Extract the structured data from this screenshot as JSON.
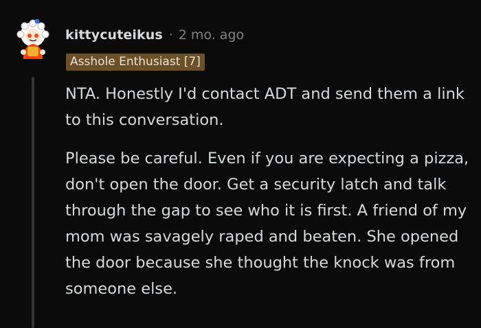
{
  "comment": {
    "username": "kittycuteikus",
    "separator": "·",
    "time_ago": "2 mo. ago",
    "flair": "Asshole Enthusiast [7]",
    "paragraphs": [
      "NTA. Honestly I'd contact ADT and send them a link to this conversation.",
      "Please be careful. Even if you are expecting a pizza, don't open the door. Get a security latch and talk through the gap to see who it is first. A friend of my mom was savagely raped and beaten. She opened the door because she thought the knock was from someone else."
    ]
  },
  "colors": {
    "background": "#0b0b0b",
    "text": "#d7dadc",
    "meta": "#818384",
    "flair_bg": "#6b5028",
    "thread_line": "#343536"
  },
  "icons": {
    "avatar": "snoo-avatar-icon"
  }
}
